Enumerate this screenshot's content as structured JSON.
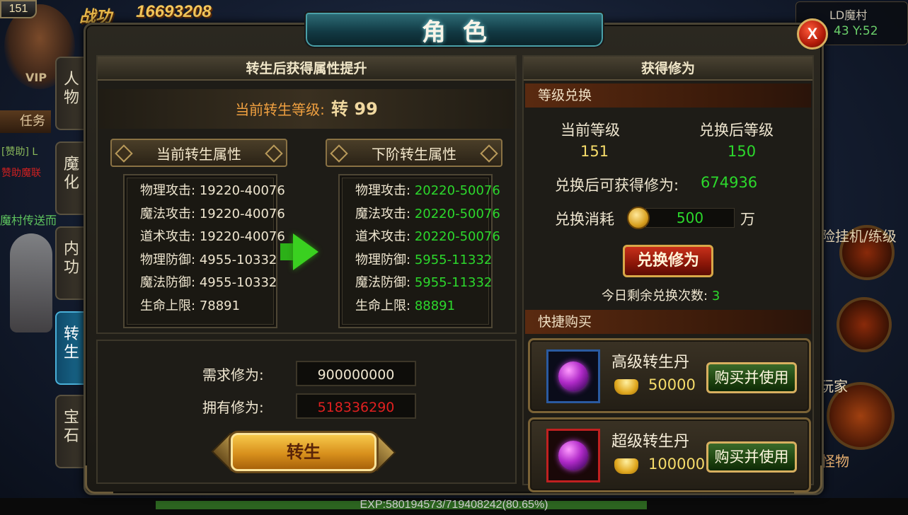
{
  "hud": {
    "level": "151",
    "vip": "VIP",
    "power_label": "战功",
    "power_value": "16693208",
    "task_label": "任务",
    "chat_line1": "[赞助] L",
    "chat_line2": "赞助魔联",
    "chat_line3": "魔村传送而",
    "map_name": "LD魔村",
    "map_coord": "43 Y:52",
    "right_text": "险挂机/练级",
    "player_label": "玩家",
    "monster_label": "怪物",
    "exp_text": "EXP:580194573/719408242(80.65%)",
    "exp_fraction": 0.8065
  },
  "window": {
    "title": "角色",
    "close_label": "X"
  },
  "tabs": [
    {
      "label1": "人",
      "label2": "物"
    },
    {
      "label1": "魔",
      "label2": "化"
    },
    {
      "label1": "内",
      "label2": "功"
    },
    {
      "label1": "转",
      "label2": "生"
    },
    {
      "label1": "宝",
      "label2": "石"
    }
  ],
  "reborn": {
    "header": "转生后获得属性提升",
    "current_level_label": "当前转生等级:",
    "current_level_value": "转 99",
    "current_attr_title": "当前转生属性",
    "next_attr_title": "下阶转生属性",
    "current_attrs": [
      {
        "key": "物理攻击:",
        "value": "19220-40076"
      },
      {
        "key": "魔法攻击:",
        "value": "19220-40076"
      },
      {
        "key": "道术攻击:",
        "value": "19220-40076"
      },
      {
        "key": "物理防御:",
        "value": "4955-10332"
      },
      {
        "key": "魔法防御:",
        "value": "4955-10332"
      },
      {
        "key": "生命上限:",
        "value": "78891"
      }
    ],
    "next_attrs": [
      {
        "key": "物理攻击:",
        "value": "20220-50076"
      },
      {
        "key": "魔法攻击:",
        "value": "20220-50076"
      },
      {
        "key": "道术攻击:",
        "value": "20220-50076"
      },
      {
        "key": "物理防御:",
        "value": "5955-11332"
      },
      {
        "key": "魔法防御:",
        "value": "5955-11332"
      },
      {
        "key": "生命上限:",
        "value": "88891"
      }
    ],
    "required_label": "需求修为:",
    "required_value": "900000000",
    "owned_label": "拥有修为:",
    "owned_value": "518336290",
    "reborn_button": "转生"
  },
  "cultivation": {
    "header": "获得修为",
    "exchange_section": "等级兑换",
    "current_level_label": "当前等级",
    "current_level_value": "151",
    "after_level_label": "兑换后等级",
    "after_level_value": "150",
    "gain_label": "兑换后可获得修为:",
    "gain_value": "674936",
    "cost_label": "兑换消耗",
    "cost_value": "500",
    "cost_unit": "万",
    "exchange_button": "兑换修为",
    "remaining_label": "今日剩余兑换次数:",
    "remaining_value": "3",
    "shop_section": "快捷购买",
    "items": [
      {
        "name": "高级转生丹",
        "price": "50000",
        "button": "购买并使用"
      },
      {
        "name": "超级转生丹",
        "price": "100000",
        "button": "购买并使用"
      }
    ]
  },
  "colors": {
    "value_green": "#2cd82c",
    "owned_red": "#e02020",
    "level_orange": "#f0a040",
    "price_gold": "#f6dc6a"
  }
}
